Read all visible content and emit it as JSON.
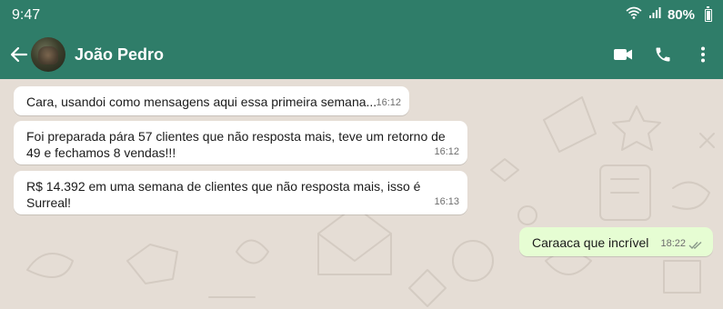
{
  "status": {
    "time": "9:47",
    "battery": "80%"
  },
  "header": {
    "contact_name": "João Pedro"
  },
  "messages": [
    {
      "text": "Cara, usandoi como mensagens aqui essa primeira semana...",
      "time": "16:12",
      "direction": "in"
    },
    {
      "text": "Foi preparada pára 57 clientes que não resposta mais, teve um retorno de 49 e fechamos 8 vendas!!!",
      "time": "16:12",
      "direction": "in"
    },
    {
      "text": "R$ 14.392 em uma semana de clientes que não resposta mais, isso é Surreal!",
      "time": "16:13",
      "direction": "in"
    },
    {
      "text": "Caraaca que incrível",
      "time": "18:22",
      "direction": "out",
      "status": "read-double-check"
    }
  ],
  "colors": {
    "header": "#2f7d69",
    "chat_bg": "#e5ddd5",
    "incoming": "#ffffff",
    "outgoing": "#e6fdd3"
  },
  "icons": [
    "back-arrow-icon",
    "video-call-icon",
    "phone-icon",
    "more-vert-icon",
    "wifi-icon",
    "signal-icon",
    "battery-icon",
    "double-check-icon"
  ]
}
